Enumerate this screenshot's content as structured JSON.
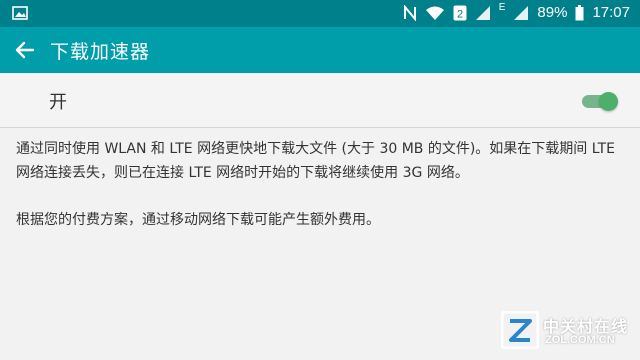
{
  "status_bar": {
    "notification_icon": "image-icon",
    "icons": [
      "nfc-icon",
      "wifi-icon",
      "sim2-icon",
      "signal-icon",
      "mobile-data-icon"
    ],
    "sim_label": "2",
    "data_label": "E",
    "battery_percent": "89%",
    "time": "17:07"
  },
  "app_bar": {
    "title": "下载加速器",
    "back_icon": "arrow-left-icon"
  },
  "toggle": {
    "label": "开",
    "state": "on"
  },
  "description": {
    "paragraph1": "通过同时使用 WLAN 和 LTE 网络更快地下载大文件 (大于 30 MB 的文件)。如果在下载期间 LTE 网络连接丢失，则已在连接 LTE 网络时开始的下载将继续使用 3G 网络。",
    "paragraph2": "根据您的付费方案，通过移动网络下载可能产生额外费用。"
  },
  "watermark": {
    "cn": "中关村在线",
    "en": "ZOL.COM.CN"
  },
  "colors": {
    "status_bar": "#00808a",
    "app_bar": "#009eaa",
    "switch_on": "#4caf6a"
  }
}
